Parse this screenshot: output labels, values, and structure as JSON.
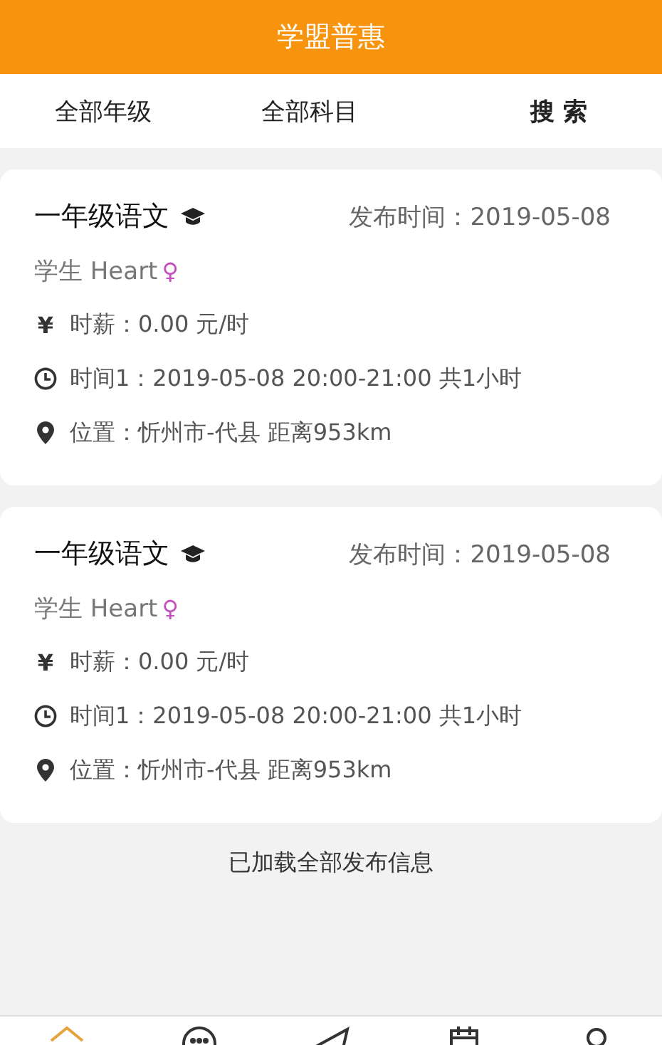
{
  "header": {
    "title": "学盟普惠"
  },
  "filters": [
    {
      "label": "全部年级",
      "kind": "filter"
    },
    {
      "label": "全部科目",
      "kind": "filter"
    },
    {
      "label": "搜 索",
      "kind": "search"
    }
  ],
  "posts": [
    {
      "subject": "一年级语文",
      "published": "发布时间：2019-05-08",
      "student": "学生 Heart",
      "gender": "♀",
      "wage": "时薪：0.00 元/时",
      "time": "时间1：2019-05-08 20:00-21:00 共1小时",
      "location": "位置：忻州市-代县 距离953km",
      "currency": "¥"
    },
    {
      "subject": "一年级语文",
      "published": "发布时间：2019-05-08",
      "student": "学生 Heart",
      "gender": "♀",
      "wage": "时薪：0.00 元/时",
      "time": "时间1：2019-05-08 20:00-21:00 共1小时",
      "location": "位置：忻州市-代县 距离953km",
      "currency": "¥"
    }
  ],
  "footer_note": "已加载全部发布信息",
  "tab_bar": [
    {
      "kind": "home",
      "selected": true
    },
    {
      "kind": "chat",
      "selected": false
    },
    {
      "kind": "send",
      "selected": false
    },
    {
      "kind": "calendar",
      "selected": false
    },
    {
      "kind": "user",
      "selected": false
    }
  ]
}
